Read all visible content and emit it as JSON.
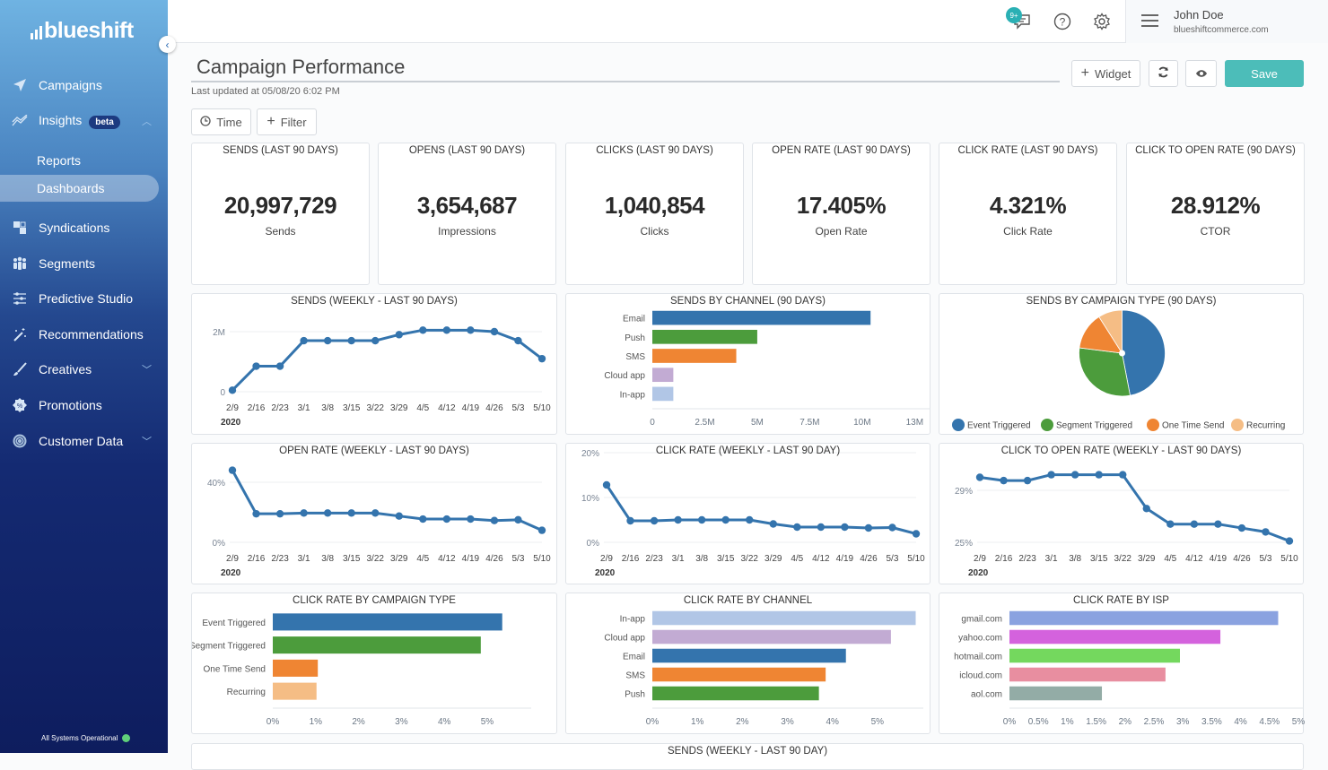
{
  "app": {
    "brand": "blueshift",
    "nav": [
      {
        "label": "Campaigns",
        "icon": "paper-plane-icon"
      },
      {
        "label": "Insights",
        "icon": "chart-line-icon",
        "badge": "beta",
        "expanded": true,
        "children": [
          {
            "label": "Reports"
          },
          {
            "label": "Dashboards",
            "active": true
          }
        ]
      },
      {
        "label": "Syndications",
        "icon": "syndications-icon"
      },
      {
        "label": "Segments",
        "icon": "people-icon"
      },
      {
        "label": "Predictive Studio",
        "icon": "sliders-icon"
      },
      {
        "label": "Recommendations",
        "icon": "magic-wand-icon"
      },
      {
        "label": "Creatives",
        "icon": "brush-icon",
        "expandable": true
      },
      {
        "label": "Promotions",
        "icon": "badge-percent-icon"
      },
      {
        "label": "Customer Data",
        "icon": "fingerprint-icon",
        "expandable": true
      }
    ],
    "status_text": "All Systems Operational",
    "status_color": "#5fd07a"
  },
  "topbar": {
    "notifications_badge": "9+",
    "user_name": "John Doe",
    "user_domain": "blueshiftcommerce.com"
  },
  "dashboard": {
    "title": "Campaign Performance",
    "last_updated": "Last updated at 05/08/20 6:02 PM",
    "buttons": {
      "widget": "Widget",
      "save": "Save",
      "time": "Time",
      "filter": "Filter"
    },
    "accent": "#4cbdb9"
  },
  "kpis": [
    {
      "title": "SENDS (LAST 90 DAYS)",
      "value": "20,997,729",
      "label": "Sends"
    },
    {
      "title": "OPENS (LAST 90 DAYS)",
      "value": "3,654,687",
      "label": "Impressions"
    },
    {
      "title": "CLICKS (LAST 90 DAYS)",
      "value": "1,040,854",
      "label": "Clicks"
    },
    {
      "title": "OPEN RATE (LAST 90 DAYS)",
      "value": "17.405%",
      "label": "Open Rate"
    },
    {
      "title": "CLICK RATE (LAST 90 DAYS)",
      "value": "4.321%",
      "label": "Click Rate"
    },
    {
      "title": "CLICK TO OPEN RATE (90 DAYS)",
      "value": "28.912%",
      "label": "CTOR"
    }
  ],
  "chart_data": [
    {
      "id": "sends-weekly",
      "type": "line",
      "title": "SENDS (WEEKLY - LAST 90 DAYS)",
      "x": [
        "2/9",
        "2/16",
        "2/23",
        "3/1",
        "3/8",
        "3/15",
        "3/22",
        "3/29",
        "4/5",
        "4/12",
        "4/19",
        "4/26",
        "5/3",
        "5/10"
      ],
      "x_sublabel": "2020",
      "values": [
        50000,
        850000,
        850000,
        1700000,
        1700000,
        1700000,
        1700000,
        1900000,
        2050000,
        2050000,
        2050000,
        2000000,
        1700000,
        1100000
      ],
      "ylim": [
        0,
        2000000
      ],
      "yticks": [
        {
          "v": 0,
          "label": "0"
        },
        {
          "v": 2000000,
          "label": "2M"
        }
      ],
      "color": "#3474ad",
      "grid": true
    },
    {
      "id": "sends-by-channel",
      "type": "bar",
      "orientation": "horizontal",
      "title": "SENDS BY CHANNEL (90 DAYS)",
      "categories": [
        "Email",
        "Push",
        "SMS",
        "Cloud app",
        "In-app"
      ],
      "values": [
        10400000,
        5000000,
        4000000,
        1000000,
        1000000
      ],
      "colors": [
        "#3474ad",
        "#4c9c3c",
        "#ef8533",
        "#c2abd3",
        "#b1c6e6"
      ],
      "xlim": [
        0,
        13000000
      ],
      "xticks": [
        {
          "v": 0,
          "label": "0"
        },
        {
          "v": 2500000,
          "label": "2.5M"
        },
        {
          "v": 5000000,
          "label": "5M"
        },
        {
          "v": 7500000,
          "label": "7.5M"
        },
        {
          "v": 10000000,
          "label": "10M"
        },
        {
          "v": 12500000,
          "label": "13M"
        }
      ]
    },
    {
      "id": "sends-by-campaign-type",
      "type": "pie",
      "title": "SENDS BY CAMPAIGN TYPE (90 DAYS)",
      "categories": [
        "Event Triggered",
        "Segment Triggered",
        "One Time Send",
        "Recurring"
      ],
      "values": [
        47,
        30,
        14,
        9
      ],
      "colors": [
        "#3474ad",
        "#4c9c3c",
        "#ef8533",
        "#f5bd85"
      ],
      "legend": "bottom"
    },
    {
      "id": "open-rate-weekly",
      "type": "line",
      "title": "OPEN RATE (WEEKLY - LAST 90 DAYS)",
      "x": [
        "2/9",
        "2/16",
        "2/23",
        "3/1",
        "3/8",
        "3/15",
        "3/22",
        "3/29",
        "4/5",
        "4/12",
        "4/19",
        "4/26",
        "5/3",
        "5/10"
      ],
      "x_sublabel": "2020",
      "values": [
        48,
        19,
        19,
        19.5,
        19.5,
        19.5,
        19.5,
        17.5,
        15.5,
        15.5,
        15.5,
        14.5,
        15,
        8
      ],
      "ylim": [
        0,
        40
      ],
      "yticks": [
        {
          "v": 0,
          "label": "0%"
        },
        {
          "v": 40,
          "label": "40%"
        }
      ],
      "color": "#3474ad",
      "grid": true
    },
    {
      "id": "click-rate-weekly",
      "type": "line",
      "title": "CLICK RATE (WEEKLY - LAST 90 DAY)",
      "x": [
        "2/9",
        "2/16",
        "2/23",
        "3/1",
        "3/8",
        "3/15",
        "3/22",
        "3/29",
        "4/5",
        "4/12",
        "4/19",
        "4/26",
        "5/3",
        "5/10"
      ],
      "x_sublabel": "2020",
      "values": [
        12.8,
        4.8,
        4.8,
        5,
        5,
        5,
        5,
        4.1,
        3.4,
        3.4,
        3.4,
        3.2,
        3.3,
        1.9
      ],
      "ylim": [
        0,
        20
      ],
      "yticks": [
        {
          "v": 0,
          "label": "0%"
        },
        {
          "v": 10,
          "label": "10%"
        },
        {
          "v": 20,
          "label": "20%"
        }
      ],
      "color": "#3474ad",
      "grid": true
    },
    {
      "id": "ctor-weekly",
      "type": "line",
      "title": "CLICK TO OPEN RATE (WEEKLY - LAST 90 DAYS)",
      "x": [
        "2/9",
        "2/16",
        "2/23",
        "3/1",
        "3/8",
        "3/15",
        "3/22",
        "3/29",
        "4/5",
        "4/12",
        "4/19",
        "4/26",
        "5/3",
        "5/10"
      ],
      "x_sublabel": "2020",
      "values": [
        30.0,
        29.75,
        29.75,
        30.2,
        30.2,
        30.2,
        30.2,
        27.6,
        26.4,
        26.4,
        26.4,
        26.1,
        25.8,
        25.1
      ],
      "ylim": [
        25,
        29
      ],
      "yticks": [
        {
          "v": 25,
          "label": "25%"
        },
        {
          "v": 29,
          "label": "29%"
        }
      ],
      "color": "#3474ad",
      "grid": true
    },
    {
      "id": "click-rate-by-campaign-type",
      "type": "bar",
      "orientation": "horizontal",
      "title": "CLICK RATE BY CAMPAIGN TYPE",
      "categories": [
        "Event Triggered",
        "Segment Triggered",
        "One Time Send",
        "Recurring"
      ],
      "values": [
        5.35,
        4.85,
        1.05,
        1.02
      ],
      "colors": [
        "#3474ad",
        "#4c9c3c",
        "#ef8533",
        "#f5bd85"
      ],
      "xlim": [
        0,
        5.9
      ],
      "xticks": [
        {
          "v": 0,
          "label": "0%"
        },
        {
          "v": 1,
          "label": "1%"
        },
        {
          "v": 2,
          "label": "2%"
        },
        {
          "v": 3,
          "label": "3%"
        },
        {
          "v": 4,
          "label": "4%"
        },
        {
          "v": 5,
          "label": "5%"
        }
      ]
    },
    {
      "id": "click-rate-by-channel",
      "type": "bar",
      "orientation": "horizontal",
      "title": "CLICK RATE BY CHANNEL",
      "categories": [
        "In-app",
        "Cloud app",
        "Email",
        "SMS",
        "Push"
      ],
      "values": [
        5.85,
        5.3,
        4.3,
        3.85,
        3.7
      ],
      "colors": [
        "#b1c6e6",
        "#c2abd3",
        "#3474ad",
        "#ef8533",
        "#4c9c3c"
      ],
      "xlim": [
        0,
        5.9
      ],
      "xticks": [
        {
          "v": 0,
          "label": "0%"
        },
        {
          "v": 1,
          "label": "1%"
        },
        {
          "v": 2,
          "label": "2%"
        },
        {
          "v": 3,
          "label": "3%"
        },
        {
          "v": 4,
          "label": "4%"
        },
        {
          "v": 5,
          "label": "5%"
        }
      ]
    },
    {
      "id": "click-rate-by-isp",
      "type": "bar",
      "orientation": "horizontal",
      "title": "CLICK RATE BY ISP",
      "categories": [
        "gmail.com",
        "yahoo.com",
        "hotmail.com",
        "icloud.com",
        "aol.com"
      ],
      "values": [
        4.65,
        3.65,
        2.95,
        2.7,
        1.6
      ],
      "colors": [
        "#8aa2e0",
        "#d462dd",
        "#74d85e",
        "#e88ea0",
        "#93aca6"
      ],
      "xlim": [
        0,
        5
      ],
      "xticks": [
        {
          "v": 0,
          "label": "0%"
        },
        {
          "v": 0.5,
          "label": "0.5%"
        },
        {
          "v": 1,
          "label": "1%"
        },
        {
          "v": 1.5,
          "label": "1.5%"
        },
        {
          "v": 2,
          "label": "2%"
        },
        {
          "v": 2.5,
          "label": "2.5%"
        },
        {
          "v": 3,
          "label": "3%"
        },
        {
          "v": 3.5,
          "label": "3.5%"
        },
        {
          "v": 4,
          "label": "4%"
        },
        {
          "v": 4.5,
          "label": "4.5%"
        },
        {
          "v": 5,
          "label": "5%"
        }
      ]
    }
  ],
  "next_widget_title": "SENDS (WEEKLY - LAST 90 DAY)"
}
